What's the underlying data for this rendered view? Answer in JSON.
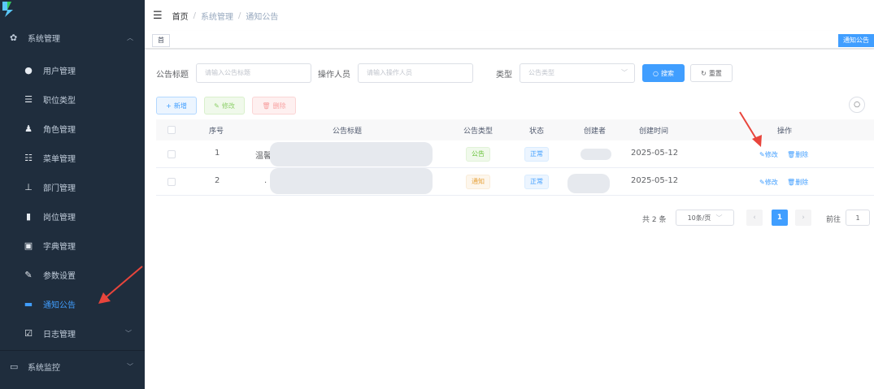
{
  "sidebar": {
    "group_system": "系统管理",
    "items": [
      {
        "label": "用户管理",
        "icon": "user-icon"
      },
      {
        "label": "职位类型",
        "icon": "list-icon"
      },
      {
        "label": "角色管理",
        "icon": "peoples-icon"
      },
      {
        "label": "菜单管理",
        "icon": "tree-table-icon"
      },
      {
        "label": "部门管理",
        "icon": "tree-icon"
      },
      {
        "label": "岗位管理",
        "icon": "post-icon"
      },
      {
        "label": "字典管理",
        "icon": "dict-icon"
      },
      {
        "label": "参数设置",
        "icon": "edit-icon"
      },
      {
        "label": "通知公告",
        "icon": "message-icon",
        "active": true
      },
      {
        "label": "日志管理",
        "icon": "log-icon"
      }
    ],
    "group_monitor": "系统监控"
  },
  "navbar": {
    "breadcrumb": [
      "首页",
      "系统管理",
      "通知公告"
    ],
    "separator": "/"
  },
  "tags": {
    "first": "首",
    "active": "通知公告"
  },
  "search": {
    "title_label": "公告标题",
    "title_placeholder": "请输入公告标题",
    "operator_label": "操作人员",
    "operator_placeholder": "请输入操作人员",
    "type_label": "类型",
    "type_placeholder": "公告类型",
    "search_button": "搜索",
    "reset_button": "重置"
  },
  "toolbar": {
    "add": "新增",
    "edit": "修改",
    "delete": "删除"
  },
  "table": {
    "headers": [
      "序号",
      "公告标题",
      "公告类型",
      "状态",
      "创建者",
      "创建时间",
      "操作"
    ],
    "rows": [
      {
        "index": "1",
        "title": "温馨",
        "type": "公告",
        "status": "正常",
        "creator": "",
        "created": "2025-05-12",
        "edit": "修改",
        "delete": "删除"
      },
      {
        "index": "2",
        "title": ".",
        "type": "通知",
        "status": "正常",
        "creator": "",
        "created": "2025-05-12",
        "edit": "修改",
        "delete": "删除"
      }
    ]
  },
  "pagination": {
    "total": "共 2 条",
    "page_size": "10条/页",
    "current": "1",
    "goto_label": "前往",
    "goto_value": "1"
  },
  "colors": {
    "sidebar_bg": "#1f2d3d",
    "accent": "#409eff",
    "annotation_arrow": "#e8453c"
  }
}
